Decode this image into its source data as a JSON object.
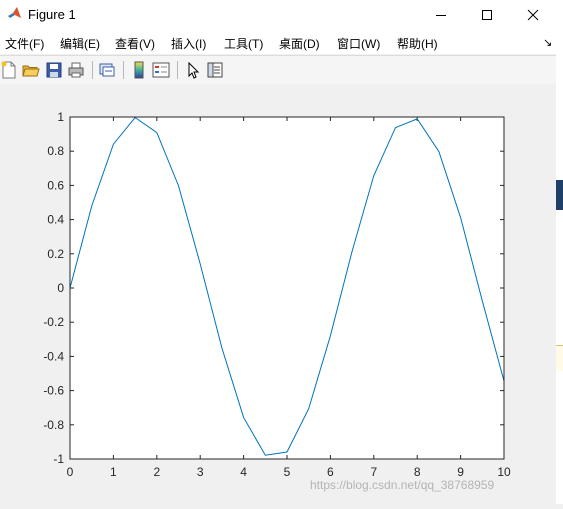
{
  "window": {
    "title": "Figure 1"
  },
  "menu": {
    "items": [
      "文件(F)",
      "编辑(E)",
      "查看(V)",
      "插入(I)",
      "工具(T)",
      "桌面(D)",
      "窗口(W)",
      "帮助(H)"
    ],
    "overflow": "↘"
  },
  "toolbar": {
    "tools": [
      "new-figure-icon",
      "open-file-icon",
      "save-icon",
      "print-icon",
      "link-plot-icon",
      "insert-colorbar-icon",
      "insert-legend-icon",
      "edit-plot-pointer-icon",
      "property-inspector-icon"
    ]
  },
  "watermark": "https://blog.csdn.net/qq_38768959",
  "colors": {
    "line": "#0072bd",
    "titlebar": "#ffffff",
    "background": "#f0f0f0"
  },
  "chart_data": {
    "type": "line",
    "title": "",
    "xlabel": "",
    "ylabel": "",
    "xlim": [
      0,
      10
    ],
    "ylim": [
      -1,
      1
    ],
    "x_ticks": [
      "0",
      "1",
      "2",
      "3",
      "4",
      "5",
      "6",
      "7",
      "8",
      "9",
      "10"
    ],
    "y_ticks": [
      "-1",
      "-0.8",
      "-0.6",
      "-0.4",
      "-0.2",
      "0",
      "0.2",
      "0.4",
      "0.6",
      "0.8",
      "1"
    ],
    "grid": false,
    "series": [
      {
        "x": [
          0,
          0.5,
          1,
          1.5,
          2,
          2.5,
          3,
          3.5,
          4,
          4.5,
          5,
          5.5,
          6,
          6.5,
          7,
          7.5,
          8,
          8.5,
          9,
          9.5,
          10
        ],
        "y": [
          0,
          0.479,
          0.841,
          0.997,
          0.909,
          0.598,
          0.141,
          -0.351,
          -0.757,
          -0.978,
          -0.959,
          -0.706,
          -0.279,
          0.215,
          0.657,
          0.938,
          0.989,
          0.798,
          0.412,
          -0.075,
          -0.544
        ]
      }
    ]
  }
}
